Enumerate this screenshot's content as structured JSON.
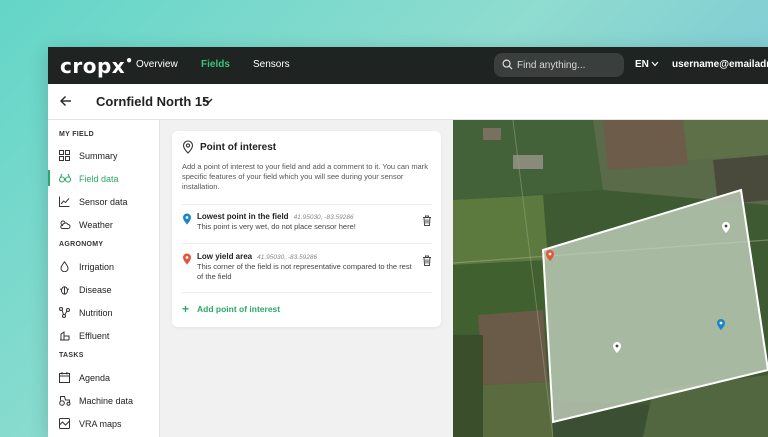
{
  "app": {
    "logo_text": "cropx"
  },
  "nav": {
    "items": [
      {
        "label": "Overview",
        "active": false
      },
      {
        "label": "Fields",
        "active": true
      },
      {
        "label": "Sensors",
        "active": false
      }
    ],
    "search_placeholder": "Find anything...",
    "language": "EN",
    "user": "username@emailadress"
  },
  "titlebar": {
    "field_name": "Cornfield North 15"
  },
  "sidebar": {
    "sections": [
      {
        "label": "MY FIELD",
        "items": [
          {
            "label": "Summary",
            "icon": "grid-icon",
            "active": false
          },
          {
            "label": "Field data",
            "icon": "binoculars-icon",
            "active": true
          },
          {
            "label": "Sensor data",
            "icon": "chart-icon",
            "active": false
          },
          {
            "label": "Weather",
            "icon": "weather-icon",
            "active": false
          }
        ]
      },
      {
        "label": "AGRONOMY",
        "items": [
          {
            "label": "Irrigation",
            "icon": "water-drop-icon",
            "active": false
          },
          {
            "label": "Disease",
            "icon": "bug-icon",
            "active": false
          },
          {
            "label": "Nutrition",
            "icon": "nutrition-icon",
            "active": false
          },
          {
            "label": "Effluent",
            "icon": "effluent-icon",
            "active": false
          }
        ]
      },
      {
        "label": "TASKS",
        "items": [
          {
            "label": "Agenda",
            "icon": "calendar-icon",
            "active": false
          },
          {
            "label": "Machine data",
            "icon": "tractor-icon",
            "active": false
          },
          {
            "label": "VRA maps",
            "icon": "map-icon",
            "active": false
          }
        ]
      }
    ]
  },
  "poi_card": {
    "title": "Point of interest",
    "description": "Add a point of interest to your field and add a comment to it. You can mark specific features of your field which you will see during your sensor installation.",
    "items": [
      {
        "name": "Lowest point in the field",
        "coords": "41.95030, -83.59286",
        "comment": "This point is very wet, do not place sensor here!",
        "pin_color": "#1a86c8"
      },
      {
        "name": "Low yield area",
        "coords": "41.95030, -83.59286",
        "comment": "This corner of the field is not representative compared to the rest of the field",
        "pin_color": "#e4553a"
      }
    ],
    "add_label": "Add point of interest"
  },
  "colors": {
    "accent": "#2aa86a",
    "topbar": "#1f2321"
  }
}
